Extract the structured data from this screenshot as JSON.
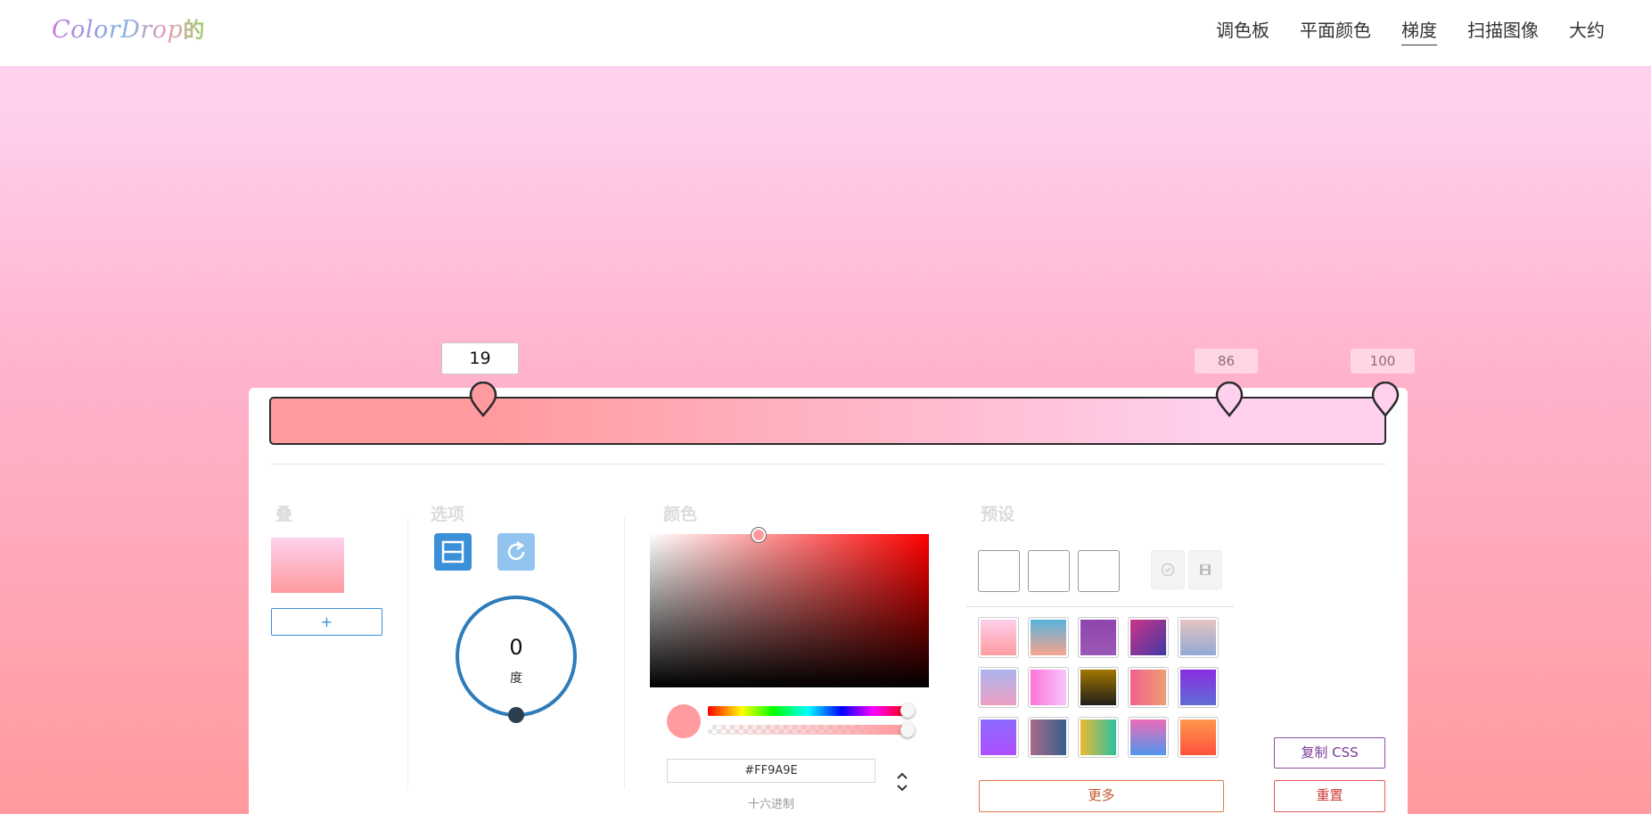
{
  "app": {
    "logo_text": "ColorDrop",
    "logo_suffix": "的"
  },
  "nav": {
    "items": [
      {
        "label": "调色板",
        "active": false
      },
      {
        "label": "平面颜色",
        "active": false
      },
      {
        "label": "梯度",
        "active": true
      },
      {
        "label": "扫描图像",
        "active": false
      },
      {
        "label": "大约",
        "active": false
      }
    ]
  },
  "gradient": {
    "stops": [
      {
        "position": 19,
        "color": "#FF9A9E",
        "label": "19",
        "selected": true
      },
      {
        "position": 86,
        "color": "#FFD1EF",
        "label": "86",
        "selected": false
      },
      {
        "position": 100,
        "color": "#FFD1EF",
        "label": "100",
        "selected": false
      }
    ]
  },
  "layers": {
    "title": "叠",
    "add_label": "+"
  },
  "options": {
    "title": "选项",
    "angle_value": "0",
    "angle_unit": "度",
    "angle_degrees": 0
  },
  "color": {
    "title": "颜色",
    "hex_value": "#FF9A9E",
    "hex_label": "十六进制",
    "current": "#FF9A9E"
  },
  "presets": {
    "title": "预设",
    "swatches": [
      "linear-gradient(180deg,#ffd1ef,#ff9a9e)",
      "linear-gradient(180deg,#4fb3e0,#ffa48a)",
      "linear-gradient(180deg,#8e44ad,#9b59b6)",
      "linear-gradient(135deg,#d63384,#3a3aa8)",
      "linear-gradient(180deg,#e8c6c0,#8fa8d6)",
      "linear-gradient(180deg,#a7b5f0,#f0a0c0)",
      "linear-gradient(90deg,#ff6fd8,#f5c9ff)",
      "linear-gradient(180deg,#a87b00,#1a1a1a)",
      "linear-gradient(90deg,#ef5f8f,#f0a070)",
      "linear-gradient(180deg,#8a2be2,#5f6fd6)",
      "linear-gradient(180deg,#8a6cff,#b04cff)",
      "linear-gradient(90deg,#b06a8a,#2f5f8a)",
      "linear-gradient(90deg,#f5b82e,#22c0a8)",
      "linear-gradient(180deg,#f36ab4,#4a98f0)",
      "linear-gradient(180deg,#ff9a4e,#ff4f3a)"
    ],
    "more_label": "更多"
  },
  "actions": {
    "copy_css_label": "复制 CSS",
    "reset_label": "重置"
  }
}
